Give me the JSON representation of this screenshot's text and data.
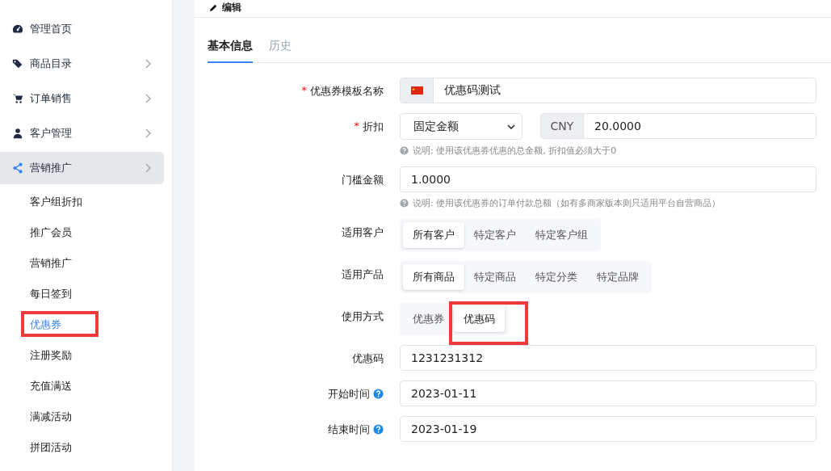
{
  "sidebar": {
    "items": [
      {
        "label": "管理首页",
        "has_arrow": false,
        "expanded": false,
        "selected": false
      },
      {
        "label": "商品目录",
        "has_arrow": true,
        "expanded": false,
        "selected": false
      },
      {
        "label": "订单销售",
        "has_arrow": true,
        "expanded": false,
        "selected": false
      },
      {
        "label": "客户管理",
        "has_arrow": true,
        "expanded": false,
        "selected": false
      },
      {
        "label": "营销推广",
        "has_arrow": true,
        "expanded": true,
        "selected": false,
        "children": [
          {
            "label": "客户组折扣",
            "selected": false,
            "annotated": false
          },
          {
            "label": "推广会员",
            "selected": false,
            "annotated": false
          },
          {
            "label": "营销推广",
            "selected": false,
            "annotated": false
          },
          {
            "label": "每日签到",
            "selected": false,
            "annotated": false
          },
          {
            "label": "优惠券",
            "selected": true,
            "annotated": true
          },
          {
            "label": "注册奖励",
            "selected": false,
            "annotated": false
          },
          {
            "label": "充值满送",
            "selected": false,
            "annotated": false
          },
          {
            "label": "满减活动",
            "selected": false,
            "annotated": false
          },
          {
            "label": "拼团活动",
            "selected": false,
            "annotated": false
          }
        ]
      }
    ]
  },
  "header": {
    "title": "编辑"
  },
  "tabs": [
    {
      "label": "基本信息",
      "selected": true
    },
    {
      "label": "历史",
      "selected": false
    }
  ],
  "form": {
    "fields": [
      {
        "kind": "flag-input",
        "label": "优惠券模板名称",
        "required_marker": "*",
        "value": "优惠码测试"
      },
      {
        "kind": "select-currency",
        "label": "折扣",
        "required_marker": "*",
        "value": "固定金额",
        "currency": "CNY",
        "amount": "20.0000",
        "help": "说明: 使用该优惠券优惠的总金额, 折扣值必须大于0"
      },
      {
        "kind": "input",
        "label": "门槛金额",
        "value": "1.0000",
        "help": "说明: 使用该优惠券的订单付款总额（如有多商家版本则只适用平台自营商品）"
      },
      {
        "kind": "segmented",
        "label": "适用客户",
        "options": [
          {
            "label": "所有客户",
            "selected": true,
            "annotated": false
          },
          {
            "label": "特定客户",
            "selected": false,
            "annotated": false
          },
          {
            "label": "特定客户组",
            "selected": false,
            "annotated": false
          }
        ]
      },
      {
        "kind": "segmented",
        "label": "适用产品",
        "options": [
          {
            "label": "所有商品",
            "selected": true,
            "annotated": false
          },
          {
            "label": "特定商品",
            "selected": false,
            "annotated": false
          },
          {
            "label": "特定分类",
            "selected": false,
            "annotated": false
          },
          {
            "label": "特定品牌",
            "selected": false,
            "annotated": false
          }
        ]
      },
      {
        "kind": "segmented",
        "label": "使用方式",
        "options": [
          {
            "label": "优惠券",
            "selected": false,
            "annotated": false
          },
          {
            "label": "优惠码",
            "selected": true,
            "annotated": true
          }
        ]
      },
      {
        "kind": "input",
        "label": "优惠码",
        "value": "1231231312"
      },
      {
        "kind": "input",
        "label": "开始时间",
        "info": true,
        "value": "2023-01-11"
      },
      {
        "kind": "input",
        "label": "结束时间",
        "info": true,
        "value": "2023-01-19"
      }
    ]
  }
}
